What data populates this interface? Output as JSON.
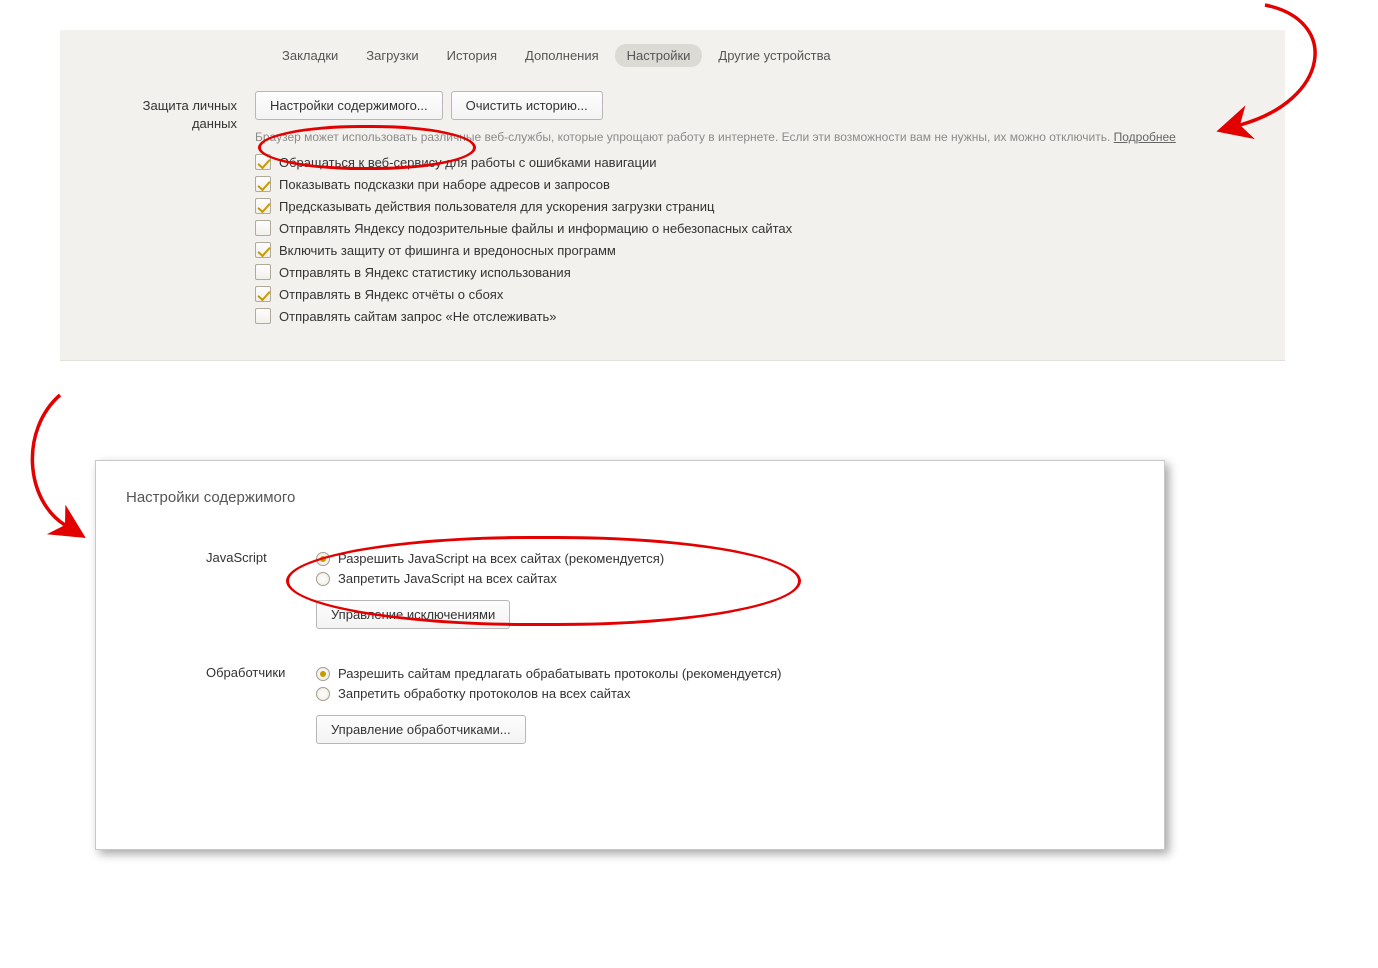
{
  "tabs": {
    "bookmarks": "Закладки",
    "downloads": "Загрузки",
    "history": "История",
    "addons": "Дополнения",
    "settings": "Настройки",
    "other_devices": "Другие устройства"
  },
  "privacy": {
    "section_label_l1": "Защита личных",
    "section_label_l2": "данных",
    "btn_content_settings": "Настройки содержимого...",
    "btn_clear_history": "Очистить историю...",
    "hint_text": "Браузер может использовать различные веб-службы, которые упрощают работу в интернете. Если эти возможности вам не нужны, их можно отключить. ",
    "hint_link": "Подробнее",
    "checks": [
      {
        "label": "Обращаться к веб-сервису для работы с ошибками навигации",
        "checked": true
      },
      {
        "label": "Показывать подсказки при наборе адресов и запросов",
        "checked": true
      },
      {
        "label": "Предсказывать действия пользователя для ускорения загрузки страниц",
        "checked": true
      },
      {
        "label": "Отправлять Яндексу подозрительные файлы и информацию о небезопасных сайтах",
        "checked": false
      },
      {
        "label": "Включить защиту от фишинга и вредоносных программ",
        "checked": true
      },
      {
        "label": "Отправлять в Яндекс статистику использования",
        "checked": false
      },
      {
        "label": "Отправлять в Яндекс отчёты о сбоях",
        "checked": true
      },
      {
        "label": "Отправлять сайтам запрос «Не отслеживать»",
        "checked": false
      }
    ]
  },
  "dialog": {
    "title": "Настройки содержимого",
    "javascript": {
      "label": "JavaScript",
      "opt_allow": "Разрешить JavaScript на всех сайтах (рекомендуется)",
      "opt_block": "Запретить JavaScript на всех сайтах",
      "selected": "allow",
      "btn_exceptions": "Управление исключениями"
    },
    "handlers": {
      "label": "Обработчики",
      "opt_allow": "Разрешить сайтам предлагать обрабатывать протоколы (рекомендуется)",
      "opt_block": "Запретить обработку протоколов на всех сайтах",
      "selected": "allow",
      "btn_manage": "Управление обработчиками..."
    }
  }
}
